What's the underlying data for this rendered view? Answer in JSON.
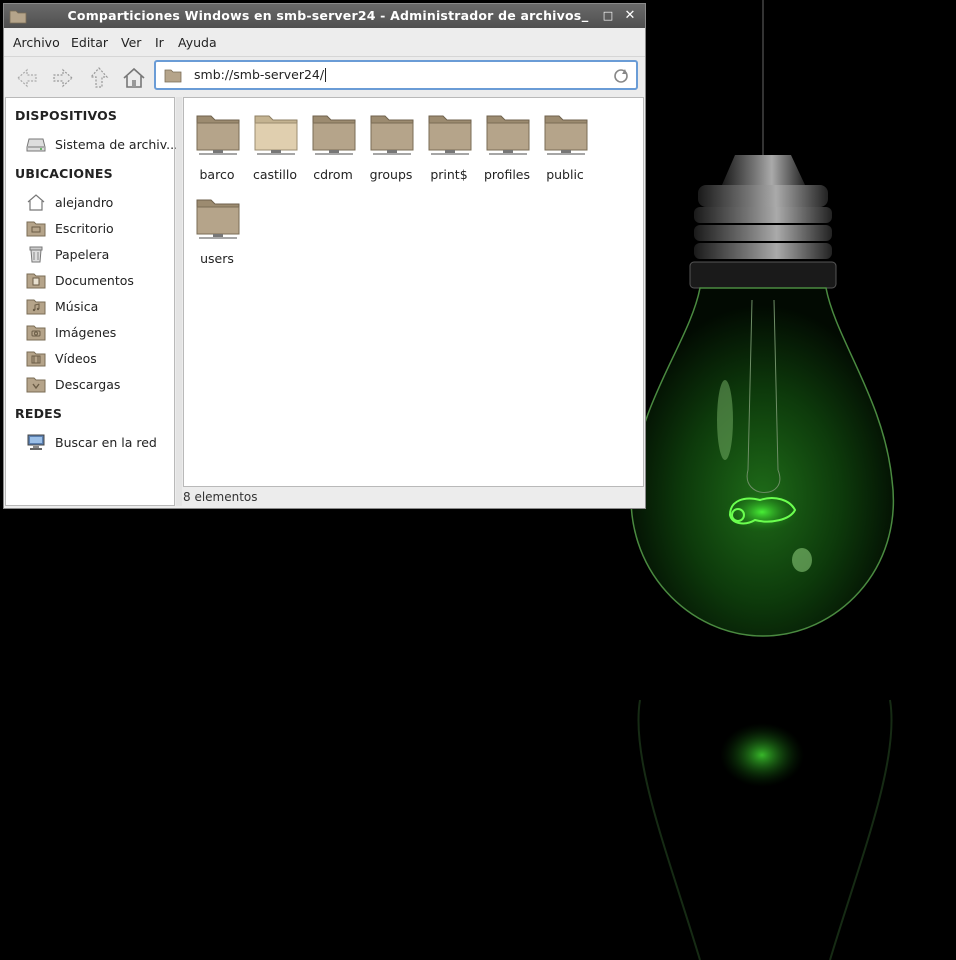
{
  "window": {
    "title": "Comparticiones Windows en smb-server24 - Administrador de archivos",
    "controls": {
      "minimize": "_",
      "maximize": "□",
      "close": "✕"
    }
  },
  "menubar": [
    "Archivo",
    "Editar",
    "Ver",
    "Ir",
    "Ayuda"
  ],
  "toolbar": {
    "back_icon": "back-arrow-icon",
    "forward_icon": "forward-arrow-icon",
    "up_icon": "up-arrow-icon",
    "home_icon": "home-icon",
    "location": "smb://smb-server24/",
    "reload_icon": "reload-icon"
  },
  "sidebar": {
    "devices_heading": "DISPOSITIVOS",
    "devices": [
      {
        "label": "Sistema de archiv...",
        "icon": "drive-icon"
      }
    ],
    "places_heading": "UBICACIONES",
    "places": [
      {
        "label": "alejandro",
        "icon": "home-icon"
      },
      {
        "label": "Escritorio",
        "icon": "desktop-folder-icon"
      },
      {
        "label": "Papelera",
        "icon": "trash-icon"
      },
      {
        "label": "Documentos",
        "icon": "documents-folder-icon"
      },
      {
        "label": "Música",
        "icon": "music-folder-icon"
      },
      {
        "label": "Imágenes",
        "icon": "pictures-folder-icon"
      },
      {
        "label": "Vídeos",
        "icon": "videos-folder-icon"
      },
      {
        "label": "Descargas",
        "icon": "downloads-folder-icon"
      }
    ],
    "network_heading": "REDES",
    "network": [
      {
        "label": "Buscar en la red",
        "icon": "network-icon"
      }
    ]
  },
  "files": [
    {
      "name": "barco",
      "selected": false
    },
    {
      "name": "castillo",
      "selected": false
    },
    {
      "name": "cdrom",
      "selected": false
    },
    {
      "name": "groups",
      "selected": false
    },
    {
      "name": "print$",
      "selected": false
    },
    {
      "name": "profiles",
      "selected": false
    },
    {
      "name": "public",
      "selected": false
    },
    {
      "name": "users",
      "selected": false
    }
  ],
  "status": "8 elementos",
  "colors": {
    "folder": "#b5a48a",
    "folder_light": "#d8c7a8",
    "glow": "#39d12f",
    "titlebar": "#5a5a5a"
  }
}
